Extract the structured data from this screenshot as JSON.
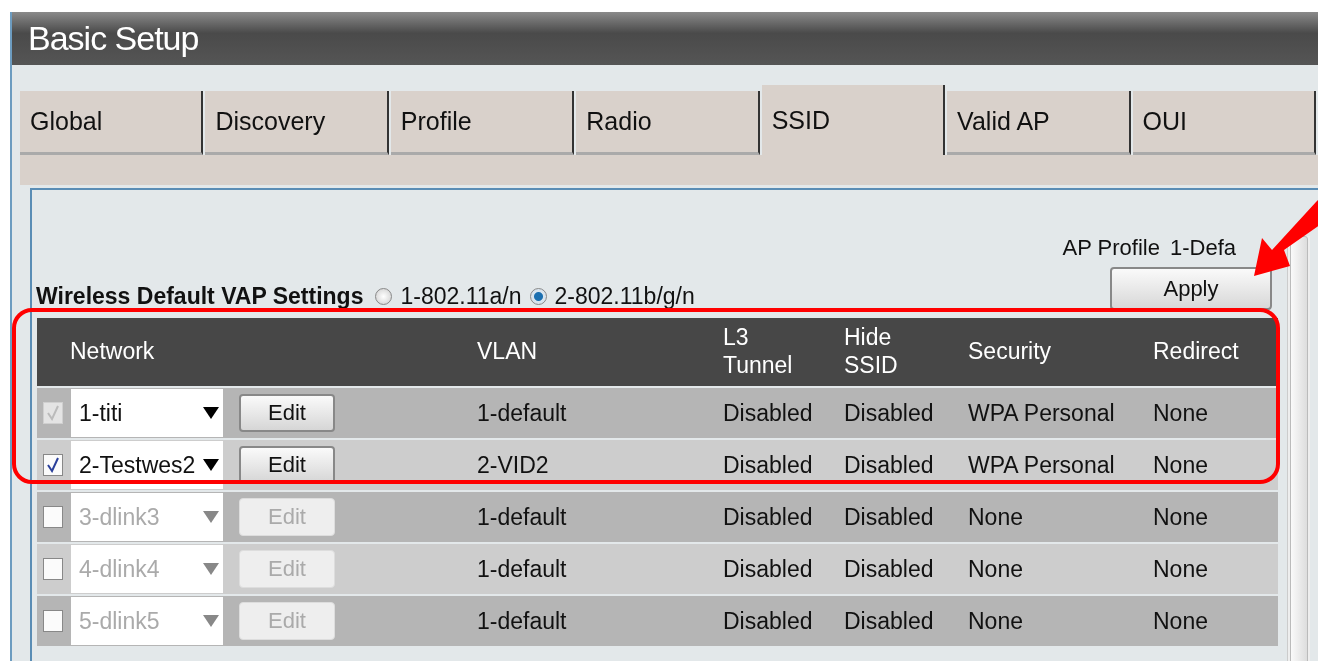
{
  "window": {
    "title": "Basic Setup"
  },
  "tabs": [
    {
      "label": "Global",
      "selected": false
    },
    {
      "label": "Discovery",
      "selected": false
    },
    {
      "label": "Profile",
      "selected": false
    },
    {
      "label": "Radio",
      "selected": false
    },
    {
      "label": "SSID",
      "selected": true
    },
    {
      "label": "Valid AP",
      "selected": false
    },
    {
      "label": "OUI",
      "selected": false
    }
  ],
  "ap_profile": {
    "label": "AP Profile",
    "value": "1-Defa"
  },
  "apply_button": "Apply",
  "vap_settings": {
    "label": "Wireless Default VAP Settings",
    "options": [
      {
        "label": "1-802.11a/n",
        "selected": false
      },
      {
        "label": "2-802.11b/g/n",
        "selected": true
      }
    ]
  },
  "table": {
    "columns": [
      "Network",
      "VLAN",
      "L3 Tunnel",
      "Hide SSID",
      "Security",
      "Redirect"
    ],
    "rows": [
      {
        "checkbox": {
          "checked": true,
          "disabled": true
        },
        "disabled": false,
        "network": "1-titi",
        "edit": "Edit",
        "vlan": "1-default",
        "l3_tunnel": "Disabled",
        "hide_ssid": "Disabled",
        "security": "WPA Personal",
        "redirect": "None"
      },
      {
        "checkbox": {
          "checked": true,
          "disabled": false
        },
        "disabled": false,
        "network": "2-Testwes2",
        "edit": "Edit",
        "vlan": "2-VID2",
        "l3_tunnel": "Disabled",
        "hide_ssid": "Disabled",
        "security": "WPA Personal",
        "redirect": "None"
      },
      {
        "checkbox": {
          "checked": false,
          "disabled": false
        },
        "disabled": true,
        "network": "3-dlink3",
        "edit": "Edit",
        "vlan": "1-default",
        "l3_tunnel": "Disabled",
        "hide_ssid": "Disabled",
        "security": "None",
        "redirect": "None"
      },
      {
        "checkbox": {
          "checked": false,
          "disabled": false
        },
        "disabled": true,
        "network": "4-dlink4",
        "edit": "Edit",
        "vlan": "1-default",
        "l3_tunnel": "Disabled",
        "hide_ssid": "Disabled",
        "security": "None",
        "redirect": "None"
      },
      {
        "checkbox": {
          "checked": false,
          "disabled": false
        },
        "disabled": true,
        "network": "5-dlink5",
        "edit": "Edit",
        "vlan": "1-default",
        "l3_tunnel": "Disabled",
        "hide_ssid": "Disabled",
        "security": "None",
        "redirect": "None"
      }
    ]
  }
}
